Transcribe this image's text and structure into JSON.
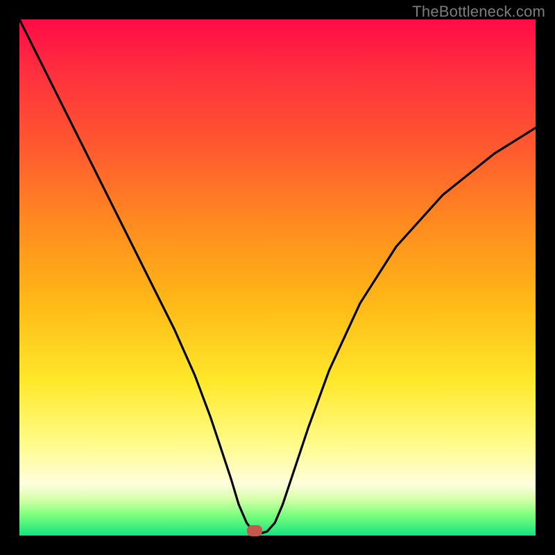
{
  "watermark": "TheBottleneck.com",
  "marker": {
    "x_pct": 45.5,
    "y_pct": 99.0,
    "color": "#c4584c"
  },
  "chart_data": {
    "type": "line",
    "title": "",
    "xlabel": "",
    "ylabel": "",
    "xlim": [
      0,
      100
    ],
    "ylim": [
      0,
      100
    ],
    "grid": false,
    "legend": false,
    "series": [
      {
        "name": "bottleneck-curve",
        "x": [
          0,
          5,
          10,
          14,
          18,
          22,
          26,
          30,
          34,
          37,
          39,
          41,
          42.5,
          44,
          45.5,
          47,
          48,
          49.5,
          51,
          53,
          56,
          60,
          66,
          73,
          82,
          92,
          100
        ],
        "y": [
          100,
          90,
          80,
          72,
          64,
          56,
          48,
          40,
          31,
          23,
          17,
          11,
          6,
          2.5,
          0.5,
          0.5,
          0.8,
          2.5,
          6,
          12,
          21,
          32,
          45,
          56,
          66,
          74,
          79
        ]
      }
    ],
    "gradient_stops": [
      {
        "pos": 0,
        "color": "#ff0b47"
      },
      {
        "pos": 10,
        "color": "#ff2f3e"
      },
      {
        "pos": 25,
        "color": "#ff5a2f"
      },
      {
        "pos": 40,
        "color": "#ff8c1f"
      },
      {
        "pos": 55,
        "color": "#ffb917"
      },
      {
        "pos": 70,
        "color": "#ffe82a"
      },
      {
        "pos": 82,
        "color": "#fffb88"
      },
      {
        "pos": 90,
        "color": "#fefedc"
      },
      {
        "pos": 93,
        "color": "#d4ffa9"
      },
      {
        "pos": 96,
        "color": "#7dff7d"
      },
      {
        "pos": 100,
        "color": "#14e27e"
      }
    ]
  }
}
